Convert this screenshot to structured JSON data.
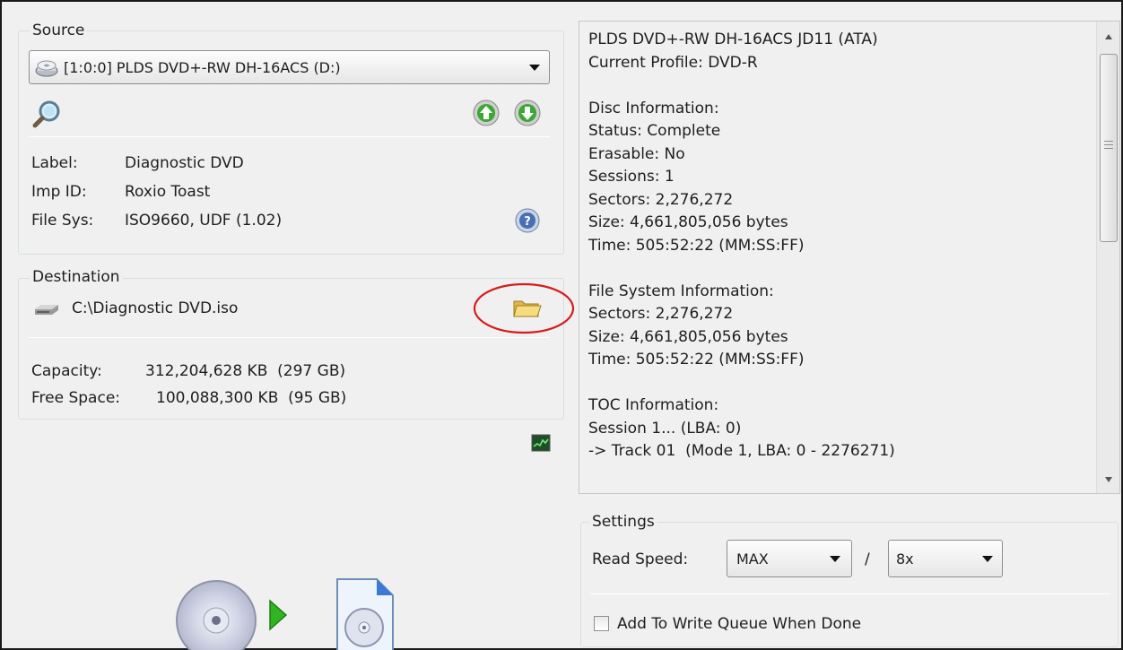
{
  "source": {
    "title": "Source",
    "drive_selected": "[1:0:0] PLDS DVD+-RW DH-16ACS (D:)",
    "label_key": "Label:",
    "label_value": "Diagnostic DVD",
    "impid_key": "Imp ID:",
    "impid_value": "Roxio Toast",
    "filesys_key": "File Sys:",
    "filesys_value": "ISO9660, UDF (1.02)"
  },
  "destination": {
    "title": "Destination",
    "path": "C:\\Diagnostic DVD.iso",
    "capacity_key": "Capacity:",
    "capacity_value": "312,204,628 KB  (297 GB)",
    "free_key": "Free Space:",
    "free_value": "100,088,300 KB  (95 GB)"
  },
  "info_panel": {
    "text": "PLDS DVD+-RW DH-16ACS JD11 (ATA)\nCurrent Profile: DVD-R\n\nDisc Information:\nStatus: Complete\nErasable: No\nSessions: 1\nSectors: 2,276,272\nSize: 4,661,805,056 bytes\nTime: 505:52:22 (MM:SS:FF)\n\nFile System Information:\nSectors: 2,276,272\nSize: 4,661,805,056 bytes\nTime: 505:52:22 (MM:SS:FF)\n\nTOC Information:\nSession 1... (LBA: 0)\n-> Track 01  (Mode 1, LBA: 0 - 2276271)"
  },
  "settings": {
    "title": "Settings",
    "read_speed_label": "Read Speed:",
    "read_speed_value": "MAX",
    "slash": "/",
    "write_speed_value": "8x",
    "add_queue_label": "Add To Write Queue When Done",
    "add_queue_checked": false
  },
  "icons": {
    "drive": "dvd-drive-icon",
    "search": "search-icon",
    "move_up": "arrow-up-icon",
    "move_down": "arrow-down-icon",
    "help": "help-icon",
    "hdd": "hard-disk-icon",
    "browse": "folder-icon",
    "graph": "activity-graph-icon",
    "disc": "disc-icon",
    "play": "play-icon",
    "image_file": "image-file-icon"
  },
  "colors": {
    "annotation_circle": "#d41c1c",
    "arrow_green": "#3aa832",
    "play_green": "#2fb520"
  }
}
